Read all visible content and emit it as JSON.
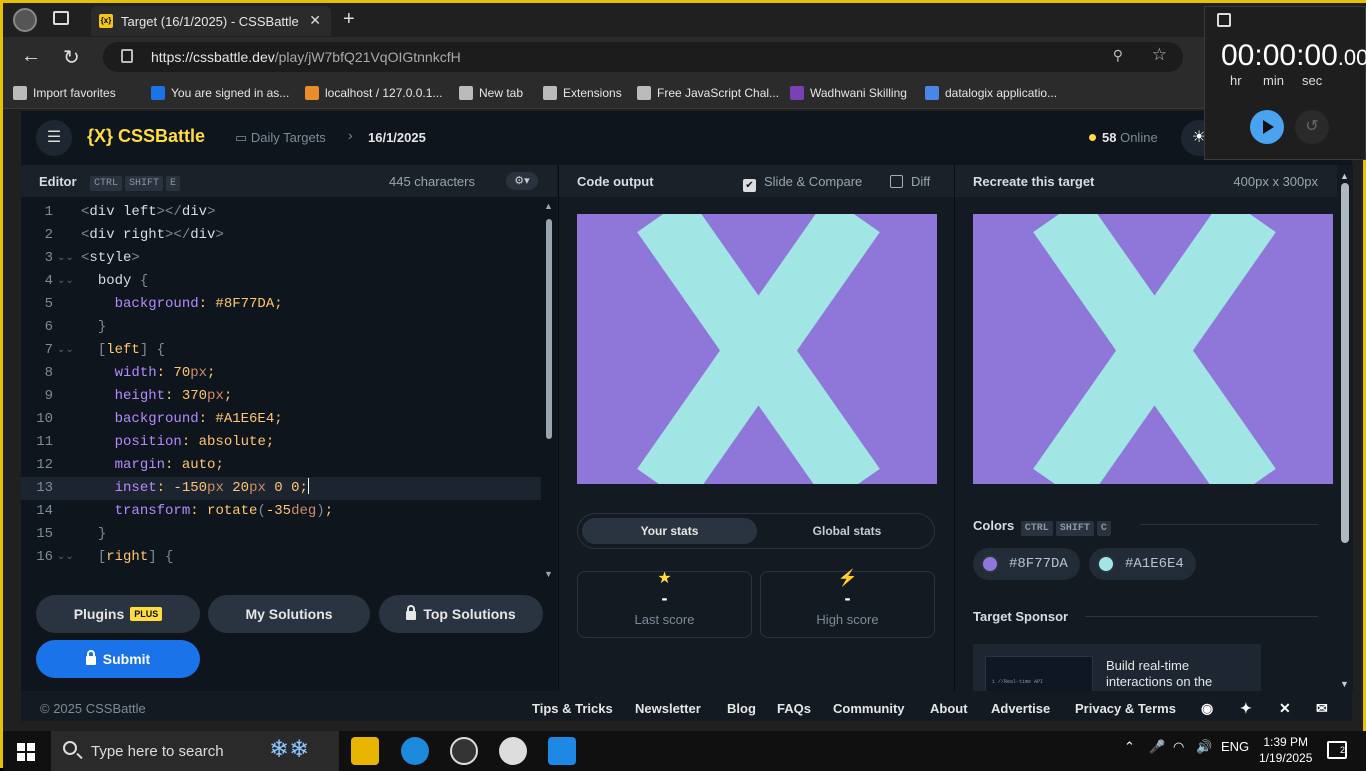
{
  "browser": {
    "tab_title": "Target (16/1/2025) - CSSBattle",
    "tab_favicon": "{x}",
    "url_host": "https://cssbattle.dev",
    "url_path": "/play/jW7bfQ21VqOIGtnnkcfH",
    "bookmarks": [
      {
        "label": "Import favorites",
        "icon": "import-icon",
        "color": "#bbbbbb"
      },
      {
        "label": "You are signed in as...",
        "icon": "s-icon",
        "color": "#1a73e8"
      },
      {
        "label": "localhost / 127.0.0.1...",
        "icon": "pma-icon",
        "color": "#e98c2a"
      },
      {
        "label": "New tab",
        "icon": "newtab-icon",
        "color": "#bbbbbb"
      },
      {
        "label": "Extensions",
        "icon": "puzzle-icon",
        "color": "#bbbbbb"
      },
      {
        "label": "Free JavaScript Chal...",
        "icon": "cube-icon",
        "color": "#bbbbbb"
      },
      {
        "label": "Wadhwani Skilling",
        "icon": "w-icon",
        "color": "#7b3fb6"
      },
      {
        "label": "datalogix applicatio...",
        "icon": "doc-icon",
        "color": "#4a86e8"
      }
    ]
  },
  "timer": {
    "time_main": "00:00:00",
    "time_frac": ".00",
    "hr": "hr",
    "min": "min",
    "sec": "sec"
  },
  "site": {
    "logo": "{X} CSSBattle",
    "crumb_daily": "Daily Targets",
    "crumb_date": "16/1/2025",
    "online_count": "58",
    "online_label": "Online"
  },
  "editor": {
    "title": "Editor",
    "keys": [
      "CTRL",
      "SHIFT",
      "E"
    ],
    "char_count": "445 characters",
    "lines": [
      {
        "n": "1",
        "fold": false,
        "html": "<span class=\"br\">&lt;</span><span class=\"tg\">div left</span><span class=\"br\">&gt;&lt;/</span><span class=\"tg\">div</span><span class=\"br\">&gt;</span>"
      },
      {
        "n": "2",
        "fold": false,
        "html": "<span class=\"br\">&lt;</span><span class=\"tg\">div right</span><span class=\"br\">&gt;&lt;/</span><span class=\"tg\">div</span><span class=\"br\">&gt;</span>"
      },
      {
        "n": "3",
        "fold": true,
        "html": "<span class=\"br\">&lt;</span><span class=\"tg\">style</span><span class=\"br\">&gt;</span>"
      },
      {
        "n": "4",
        "fold": true,
        "html": "  <span class=\"sel\">body</span> <span class=\"br\">{</span>"
      },
      {
        "n": "5",
        "fold": false,
        "html": "    <span class=\"pr\">background</span><span class=\"vl\">: #8F77DA;</span>"
      },
      {
        "n": "6",
        "fold": false,
        "html": "  <span class=\"br\">}</span>"
      },
      {
        "n": "7",
        "fold": true,
        "html": "  <span class=\"br\">[</span><span class=\"vl\">left</span><span class=\"br\">]</span> <span class=\"br\">{</span>"
      },
      {
        "n": "8",
        "fold": false,
        "html": "    <span class=\"pr\">width</span><span class=\"vl\">: 70</span><span class=\"un\">px</span><span class=\"vl\">;</span>"
      },
      {
        "n": "9",
        "fold": false,
        "html": "    <span class=\"pr\">height</span><span class=\"vl\">: 370</span><span class=\"un\">px</span><span class=\"vl\">;</span>"
      },
      {
        "n": "10",
        "fold": false,
        "html": "    <span class=\"pr\">background</span><span class=\"vl\">: #A1E6E4;</span>"
      },
      {
        "n": "11",
        "fold": false,
        "html": "    <span class=\"pr\">position</span><span class=\"vl\">: absolute;</span>"
      },
      {
        "n": "12",
        "fold": false,
        "html": "    <span class=\"pr\">margin</span><span class=\"vl\">: auto;</span>"
      },
      {
        "n": "13",
        "fold": false,
        "html": "    <span class=\"pr\">inset</span><span class=\"vl\">: -150</span><span class=\"un\">px</span><span class=\"vl\"> 20</span><span class=\"un\">px</span><span class=\"vl\"> 0 0;</span><span class=\"caret\"></span>"
      },
      {
        "n": "14",
        "fold": false,
        "html": "    <span class=\"pr\">transform</span><span class=\"vl\">: rotate</span><span class=\"br\">(</span><span class=\"vl\">-35</span><span class=\"un\">deg</span><span class=\"br\">)</span><span class=\"vl\">;</span>"
      },
      {
        "n": "15",
        "fold": false,
        "html": "  <span class=\"br\">}</span>"
      },
      {
        "n": "16",
        "fold": true,
        "html": "  <span class=\"br\">[</span><span class=\"vl\">right</span><span class=\"br\">]</span> <span class=\"br\">{</span>"
      }
    ],
    "active_line": 13
  },
  "buttons": {
    "plugins": "Plugins",
    "plugins_badge": "PLUS",
    "my_solutions": "My Solutions",
    "top_solutions": "Top Solutions",
    "submit": "Submit"
  },
  "output": {
    "title": "Code output",
    "slide_compare": "Slide & Compare",
    "diff": "Diff",
    "your_stats": "Your stats",
    "global_stats": "Global stats",
    "last_score_value": "-",
    "last_score_label": "Last score",
    "high_score_value": "-",
    "high_score_label": "High score"
  },
  "target": {
    "title": "Recreate this target",
    "size": "400px x 300px",
    "colors_title": "Colors",
    "color_keys": [
      "CTRL",
      "SHIFT",
      "C"
    ],
    "colors": [
      "#8F77DA",
      "#A1E6E4"
    ],
    "sponsor_title": "Target Sponsor",
    "sponsor_text": "Build real-time interactions on the",
    "sponsor_code": "1 //Real-time API"
  },
  "footer": {
    "copyright": "© 2025 CSSBattle",
    "links": [
      "Tips & Tricks",
      "Newsletter",
      "Blog",
      "FAQs",
      "Community",
      "About",
      "Advertise",
      "Privacy & Terms"
    ]
  },
  "taskbar": {
    "search_placeholder": "Type here to search",
    "lang": "ENG",
    "time": "1:39 PM",
    "date": "1/19/2025",
    "notifications": "2"
  },
  "colors": {
    "bg_purple": "#8F77DA",
    "shape_cyan": "#A1E6E4",
    "accent_yellow": "#ffdd40",
    "submit_blue": "#1a73e8"
  }
}
